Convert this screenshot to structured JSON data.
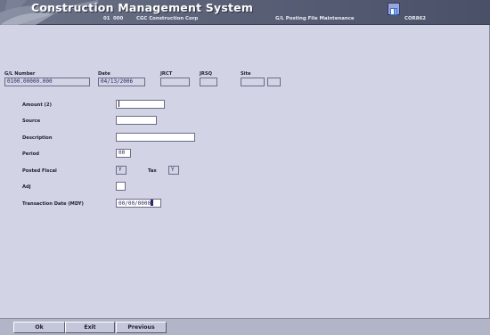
{
  "header": {
    "app_title": "Construction Management System",
    "company_code": "01",
    "division_code": "000",
    "company_name": "CGC Construction Corp",
    "screen_title": "G/L Posting File Maintenance",
    "screen_id": "COR862"
  },
  "gl_row": {
    "gl_number_label": "G/L Number",
    "gl_number_value": "0100.00000.000",
    "date_label": "Date",
    "date_value": "04/13/2006",
    "jrct_label": "JRCT",
    "jrct_value": "",
    "jrsq_label": "JRSQ",
    "jrsq_value": "",
    "site_label": "Site",
    "site_value": "",
    "site_value2": ""
  },
  "form": {
    "amount_label": "Amount (2)",
    "amount_value": "",
    "source_label": "Source",
    "source_value": "",
    "description_label": "Description",
    "description_value": "",
    "period_label": "Period",
    "period_value": "00",
    "posted_fiscal_label": "Posted Fiscal",
    "posted_fiscal_value": "Y",
    "tax_label": "Tax",
    "tax_value": "Y",
    "adj_label": "Adj",
    "adj_value": "",
    "transaction_date_label": "Transaction Date (MDY)",
    "transaction_date_value": "00/00/0000"
  },
  "footer": {
    "ok_label": "Ok",
    "exit_label": "Exit",
    "previous_label": "Previous"
  },
  "colors": {
    "background": "#d2d4e6",
    "header": "#5c6278",
    "field_text": "#2a2a60"
  }
}
